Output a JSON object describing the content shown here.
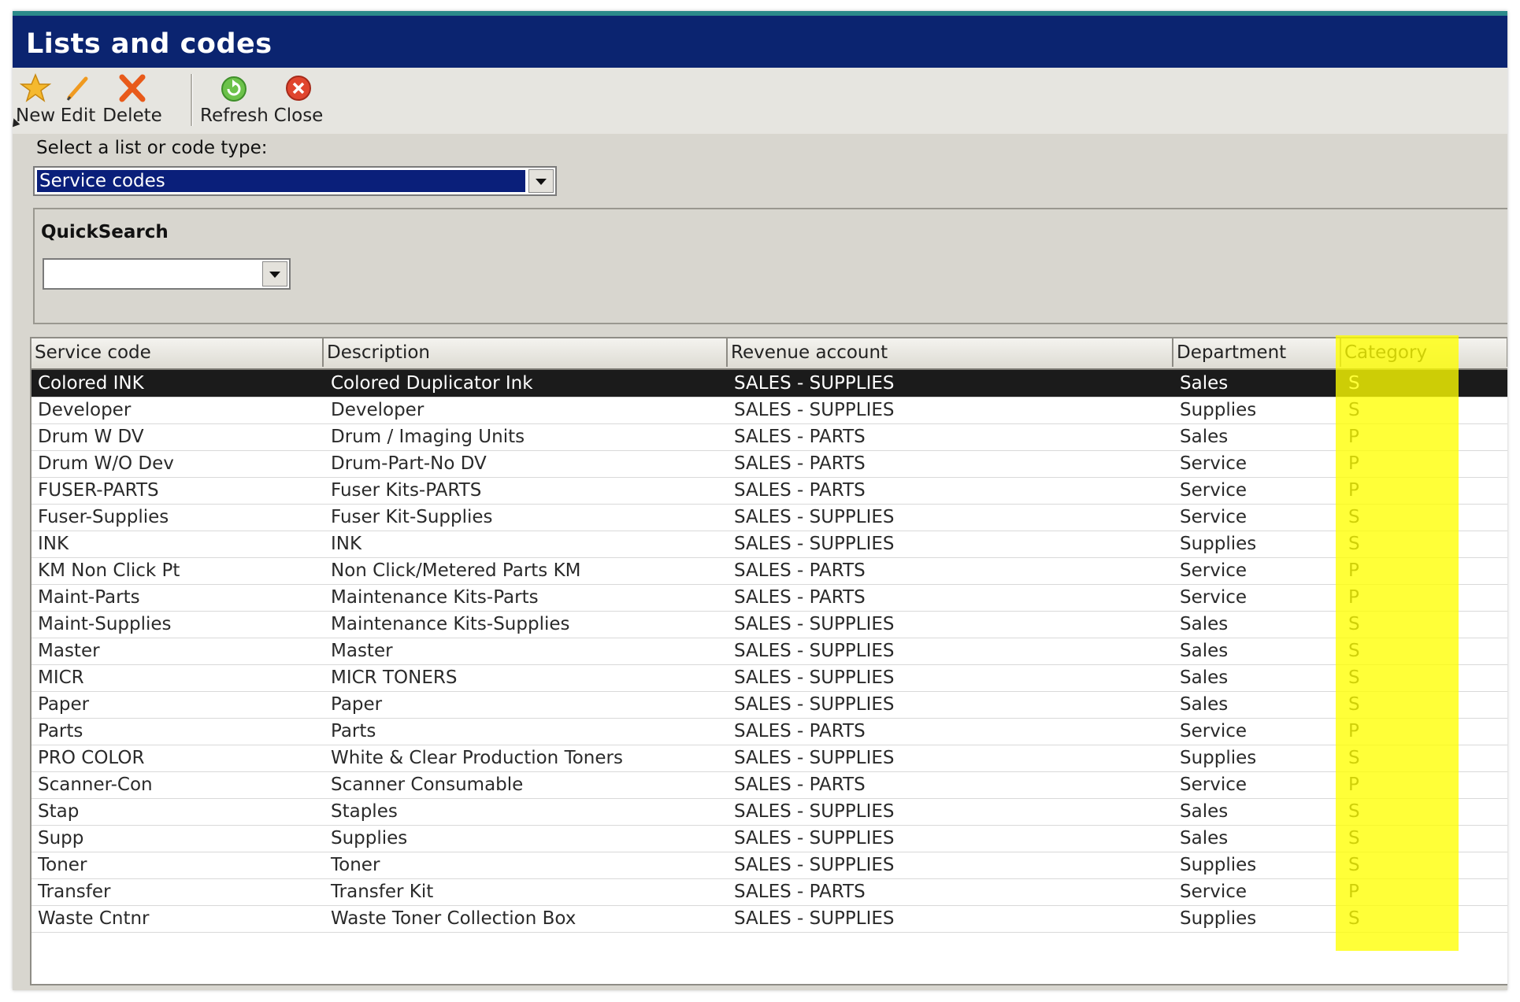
{
  "window": {
    "title": "Lists and codes"
  },
  "toolbar": {
    "new_label": "New",
    "edit_label": "Edit",
    "delete_label": "Delete",
    "refresh_label": "Refresh",
    "close_label": "Close"
  },
  "type_select": {
    "label": "Select a list or code type:",
    "value": "Service codes"
  },
  "quicksearch": {
    "title": "QuickSearch",
    "value": ""
  },
  "table": {
    "columns": [
      "Service code",
      "Description",
      "Revenue account",
      "Department",
      "Category"
    ],
    "rows": [
      [
        "Colored INK",
        "Colored Duplicator Ink",
        "SALES - SUPPLIES",
        "Sales",
        "S"
      ],
      [
        "Developer",
        "Developer",
        "SALES - SUPPLIES",
        "Supplies",
        "S"
      ],
      [
        "Drum W DV",
        "Drum / Imaging Units",
        "SALES - PARTS",
        "Sales",
        "P"
      ],
      [
        "Drum W/O Dev",
        "Drum-Part-No DV",
        "SALES - PARTS",
        "Service",
        "P"
      ],
      [
        "FUSER-PARTS",
        "Fuser Kits-PARTS",
        "SALES - PARTS",
        "Service",
        "P"
      ],
      [
        "Fuser-Supplies",
        "Fuser Kit-Supplies",
        "SALES - SUPPLIES",
        "Service",
        "S"
      ],
      [
        "INK",
        "INK",
        "SALES - SUPPLIES",
        "Supplies",
        "S"
      ],
      [
        "KM Non Click Pt",
        "Non Click/Metered Parts KM",
        "SALES - PARTS",
        "Service",
        "P"
      ],
      [
        "Maint-Parts",
        "Maintenance Kits-Parts",
        "SALES - PARTS",
        "Service",
        "P"
      ],
      [
        "Maint-Supplies",
        "Maintenance Kits-Supplies",
        "SALES - SUPPLIES",
        "Sales",
        "S"
      ],
      [
        "Master",
        "Master",
        "SALES - SUPPLIES",
        "Sales",
        "S"
      ],
      [
        "MICR",
        "MICR TONERS",
        "SALES - SUPPLIES",
        "Sales",
        "S"
      ],
      [
        "Paper",
        "Paper",
        "SALES - SUPPLIES",
        "Sales",
        "S"
      ],
      [
        "Parts",
        "Parts",
        "SALES - PARTS",
        "Service",
        "P"
      ],
      [
        "PRO COLOR",
        "White & Clear Production Toners",
        "SALES - SUPPLIES",
        "Supplies",
        "S"
      ],
      [
        "Scanner-Con",
        "Scanner Consumable",
        "SALES - PARTS",
        "Service",
        "P"
      ],
      [
        "Stap",
        "Staples",
        "SALES - SUPPLIES",
        "Sales",
        "S"
      ],
      [
        "Supp",
        "Supplies",
        "SALES - SUPPLIES",
        "Sales",
        "S"
      ],
      [
        "Toner",
        "Toner",
        "SALES - SUPPLIES",
        "Supplies",
        "S"
      ],
      [
        "Transfer",
        "Transfer Kit",
        "SALES - PARTS",
        "Service",
        "P"
      ],
      [
        "Waste Cntnr",
        "Waste Toner Collection Box",
        "SALES - SUPPLIES",
        "Supplies",
        "S"
      ]
    ],
    "selected_row": 0,
    "highlight_color": "#ffff00",
    "selection_color": "#1b1b1b"
  },
  "colors": {
    "title_bar": "#0b2470",
    "accent_line": "#2b8a8a"
  }
}
